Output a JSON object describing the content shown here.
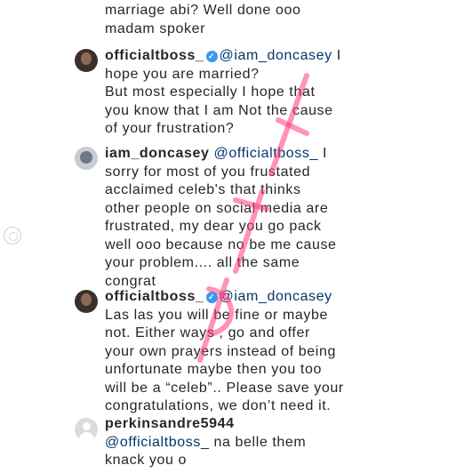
{
  "top_comment": {
    "lines": [
      "marriage abi? Well done ooo",
      "madam spoker"
    ]
  },
  "comments": [
    {
      "username": "officialtboss_",
      "verified": true,
      "mention": "@iam_doncasey",
      "first_text": " I",
      "lines": [
        "hope you are married?",
        "But most especially I hope that",
        "you know that I am Not the cause",
        "of your frustration?"
      ]
    },
    {
      "username": "iam_doncasey",
      "verified": false,
      "mention": "@officialtboss_",
      "first_text": " I",
      "lines": [
        "sorry for most of you frustated",
        "acclaimed celeb's that thinks",
        "other people on social media are",
        "frustrated, my dear you go pack",
        "well ooo because no be me cause",
        "your problem.... all the same",
        "congrat"
      ]
    },
    {
      "username": "officialtboss_",
      "verified": true,
      "mention": "@iam_doncasey",
      "first_text": "",
      "lines": [
        "Las las you will be fine or maybe",
        "not. Either ways , go and offer",
        "your own prayers instead of being",
        "unfortunate maybe then you too",
        "will be a “celeb”.. Please save your",
        "congratulations, we don’t need it."
      ]
    },
    {
      "username": "perkinsandre5944",
      "verified": false,
      "mention": "@officialtboss_",
      "mention_on_next_line": true,
      "first_text": " na belle them",
      "lines": [
        "knack you o"
      ]
    }
  ],
  "icons": {
    "verified": "verified-badge-icon",
    "side": "carousel-dot-icon"
  },
  "colors": {
    "mention": "#00376b",
    "verified": "#3897f0",
    "watermark": "#ff3c78"
  }
}
